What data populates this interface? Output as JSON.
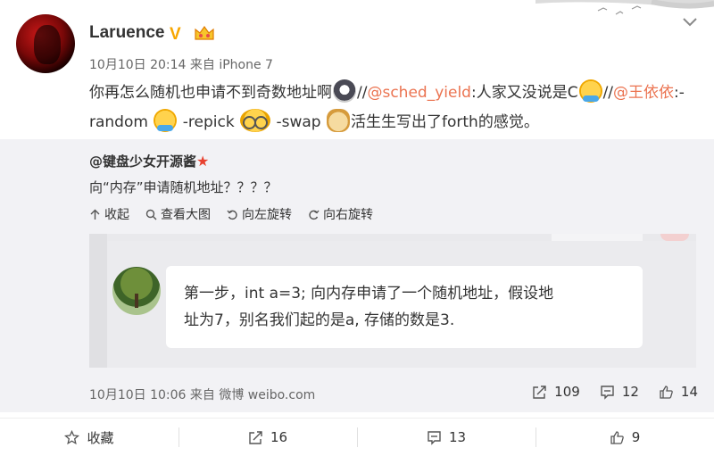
{
  "post": {
    "username": "Laruence",
    "verified_badge": "V",
    "meta": "10月10日 20:14 来自 iPhone 7",
    "text_1": "你再怎么随机也申请不到奇数地址啊",
    "text_2": "//",
    "mention_1": "@sched_yield",
    "text_3": ":人家又没说是C",
    "text_4": "//",
    "mention_2": "@王依依",
    "text_5": ":-random",
    "text_6": " -repick",
    "text_7": " -swap",
    "text_8": "活生生写出了forth的感觉。"
  },
  "repost": {
    "author": "@键盘少女开源酱",
    "text": "向“内存”申请随机地址？？？？",
    "tools": [
      {
        "label": "收起",
        "icon": "collapse-icon"
      },
      {
        "label": "查看大图",
        "icon": "search-icon"
      },
      {
        "label": "向左旋转",
        "icon": "rotate-left-icon"
      },
      {
        "label": "向右旋转",
        "icon": "rotate-right-icon"
      }
    ],
    "image_text_line1": "第一步，int a=3; 向内存申请了一个随机地址，假设地",
    "image_text_line2": "址为7，别名我们起的是a, 存储的数是3.",
    "meta": "10月10日 10:06 来自 微博 weibo.com",
    "repost_count": "109",
    "comment_count": "12",
    "like_count": "14"
  },
  "actions": {
    "favorite": "收藏",
    "repost": "16",
    "comment": "13",
    "like": "9"
  },
  "colors": {
    "link": "#eb7350",
    "badge": "#f7a600",
    "repost_bg": "#f2f2f5"
  }
}
